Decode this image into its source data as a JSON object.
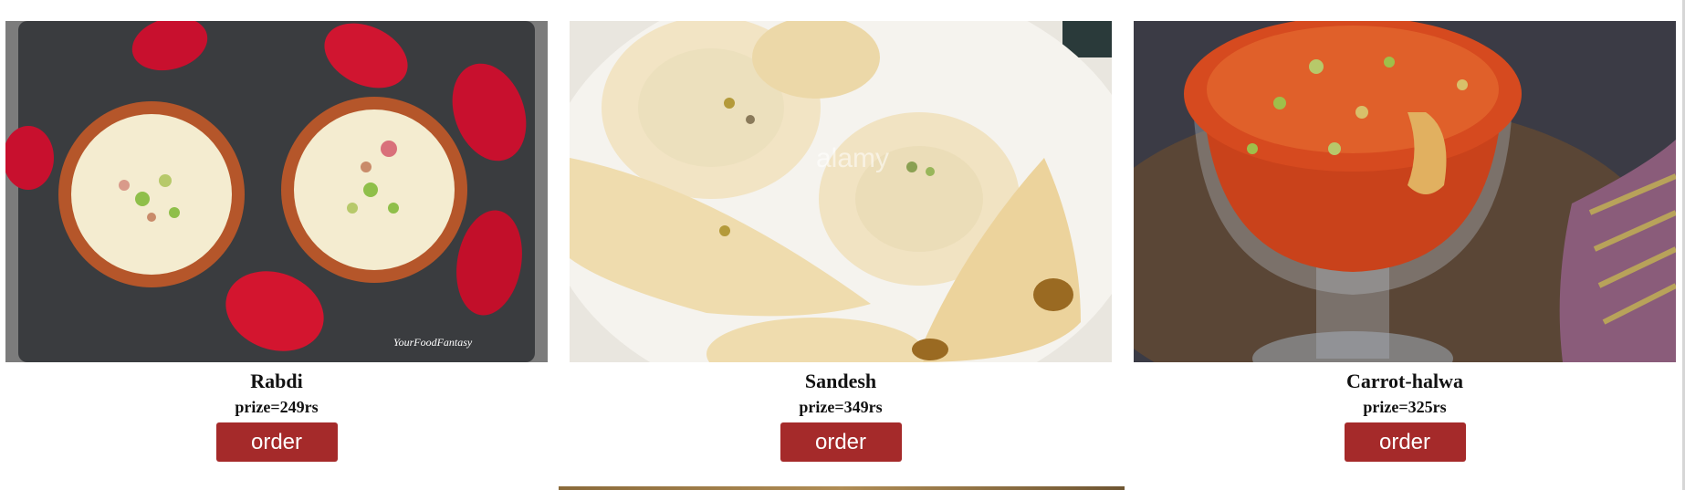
{
  "theme": {
    "button_color": "#a52a2a"
  },
  "items": [
    {
      "name": "Rabdi",
      "price": "prize=249rs",
      "order_label": "order",
      "image_watermark": "YourFoodFantasy"
    },
    {
      "name": "Sandesh",
      "price": "prize=349rs",
      "order_label": "order",
      "image_watermark": "alamy"
    },
    {
      "name": "Carrot-halwa",
      "price": "prize=325rs",
      "order_label": "order"
    }
  ]
}
